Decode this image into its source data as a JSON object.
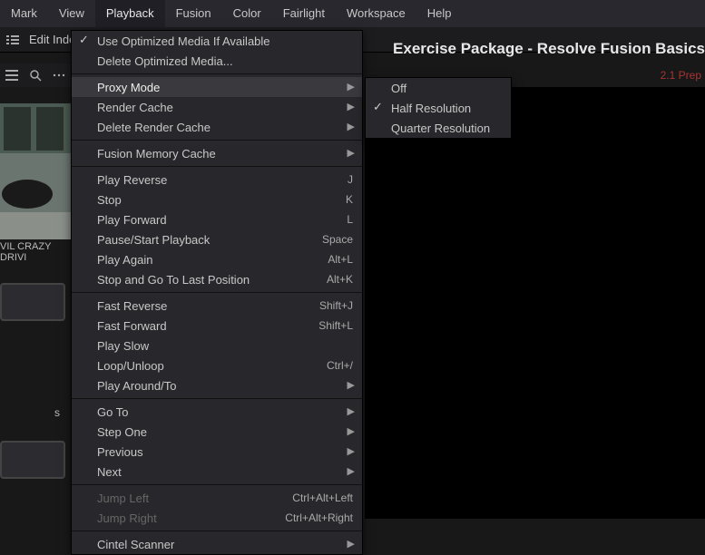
{
  "menubar": {
    "items": [
      "Mark",
      "View",
      "Playback",
      "Fusion",
      "Color",
      "Fairlight",
      "Workspace",
      "Help"
    ],
    "active_index": 2
  },
  "toolbar": {
    "edit_index_label": "Edit Inde"
  },
  "project_title": "Exercise Package - Resolve Fusion Basics",
  "clip_badge": "2.1 Prep",
  "thumbnail_label": "VIL CRAZY DRIVI",
  "bin_suffix": "s",
  "playback_menu": {
    "groups": [
      [
        {
          "label": "Use Optimized Media If Available",
          "checked": true
        },
        {
          "label": "Delete Optimized Media..."
        }
      ],
      [
        {
          "label": "Proxy Mode",
          "submenu": true,
          "highlighted": true
        },
        {
          "label": "Render Cache",
          "submenu": true
        },
        {
          "label": "Delete Render Cache",
          "submenu": true
        }
      ],
      [
        {
          "label": "Fusion Memory Cache",
          "submenu": true
        }
      ],
      [
        {
          "label": "Play Reverse",
          "shortcut": "J"
        },
        {
          "label": "Stop",
          "shortcut": "K"
        },
        {
          "label": "Play Forward",
          "shortcut": "L"
        },
        {
          "label": "Pause/Start Playback",
          "shortcut": "Space"
        },
        {
          "label": "Play Again",
          "shortcut": "Alt+L"
        },
        {
          "label": "Stop and Go To Last Position",
          "shortcut": "Alt+K"
        }
      ],
      [
        {
          "label": "Fast Reverse",
          "shortcut": "Shift+J"
        },
        {
          "label": "Fast Forward",
          "shortcut": "Shift+L"
        },
        {
          "label": "Play Slow"
        },
        {
          "label": "Loop/Unloop",
          "shortcut": "Ctrl+/"
        },
        {
          "label": "Play Around/To",
          "submenu": true
        }
      ],
      [
        {
          "label": "Go To",
          "submenu": true
        },
        {
          "label": "Step One",
          "submenu": true
        },
        {
          "label": "Previous",
          "submenu": true
        },
        {
          "label": "Next",
          "submenu": true
        }
      ],
      [
        {
          "label": "Jump Left",
          "shortcut": "Ctrl+Alt+Left",
          "disabled": true
        },
        {
          "label": "Jump Right",
          "shortcut": "Ctrl+Alt+Right",
          "disabled": true
        }
      ],
      [
        {
          "label": "Cintel Scanner",
          "submenu": true
        }
      ]
    ]
  },
  "proxy_submenu": {
    "items": [
      {
        "label": "Off"
      },
      {
        "label": "Half Resolution",
        "checked": true
      },
      {
        "label": "Quarter Resolution"
      }
    ]
  }
}
